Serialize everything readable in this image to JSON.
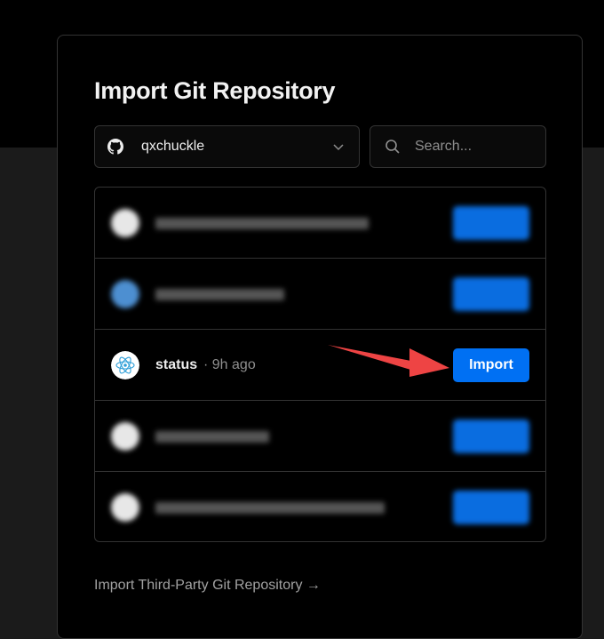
{
  "header": {
    "title": "Import Git Repository"
  },
  "account_select": {
    "value": "qxchuckle",
    "icon": "github-icon"
  },
  "search": {
    "placeholder": "Search..."
  },
  "repos": [
    {
      "name": "",
      "meta": "",
      "button": "",
      "blurred": true,
      "icon": "avatar"
    },
    {
      "name": "",
      "meta": "",
      "button": "",
      "blurred": true,
      "icon": "avatar"
    },
    {
      "name": "status",
      "meta": "· 9h ago",
      "button": "Import",
      "blurred": false,
      "icon": "react-icon"
    },
    {
      "name": "",
      "meta": "",
      "button": "",
      "blurred": true,
      "icon": "avatar"
    },
    {
      "name": "",
      "meta": "",
      "button": "",
      "blurred": true,
      "icon": "avatar"
    }
  ],
  "footer": {
    "third_party_link": "Import Third-Party Git Repository →"
  },
  "colors": {
    "accent": "#0070f3",
    "annotation_arrow": "#ee4444",
    "background": "#000000",
    "border": "#333333"
  }
}
